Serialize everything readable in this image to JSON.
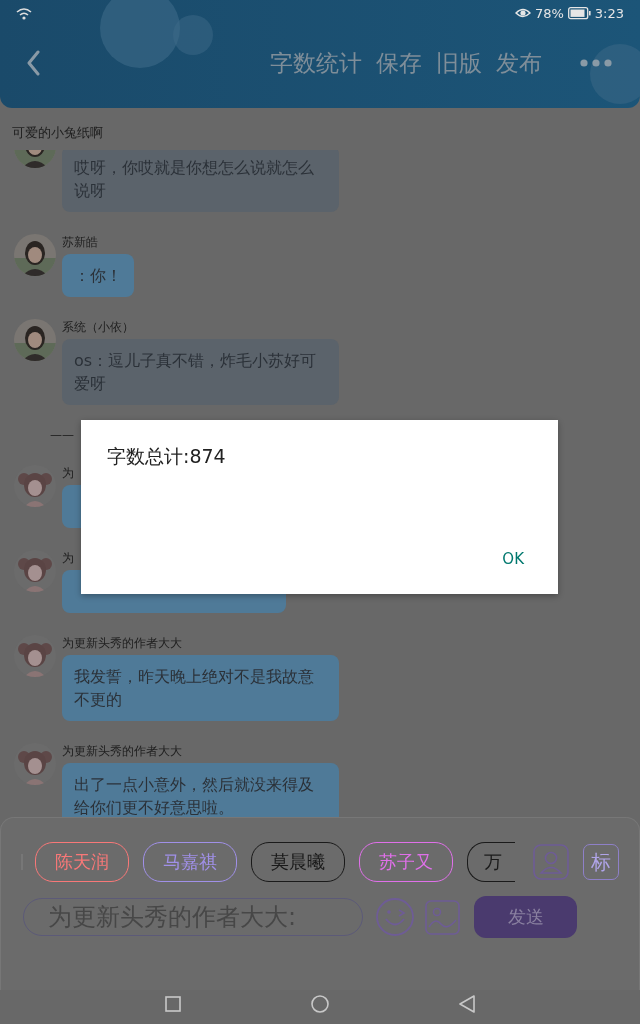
{
  "status_bar": {
    "battery": "78%",
    "time": "3:23"
  },
  "toolbar": {
    "actions": [
      "字数统计",
      "保存",
      "旧版",
      "发布"
    ]
  },
  "chat_title": "可爱的小兔纸啊",
  "messages": [
    {
      "kind": "message",
      "text": "哎呀，你哎就是你想怎么说就怎么说呀",
      "color": "#5b636b"
    },
    {
      "kind": "message",
      "sender": "苏新皓",
      "text": "：你！",
      "color": "#4f7a98"
    },
    {
      "kind": "message",
      "sender": "系统（小依）",
      "text": "os：逗儿子真不错，炸毛小苏好可爱呀",
      "color": "#5b636b"
    },
    {
      "kind": "separator",
      "text": "——"
    },
    {
      "kind": "message",
      "sender": "为",
      "color": "#4f7a98"
    },
    {
      "kind": "message",
      "sender": "为",
      "color": "#4f7a98"
    },
    {
      "kind": "message",
      "sender": "为更新头秀的作者大大",
      "text": "我发誓，昨天晚上绝对不是我故意不更的",
      "color": "#4f7a98"
    },
    {
      "kind": "message",
      "sender": "为更新头秀的作者大大",
      "text": "出了一点小意外，然后就没来得及给你们更不好意思啦。",
      "color": "#4f7a98"
    }
  ],
  "dialog": {
    "message": "字数总计:874",
    "button": "OK"
  },
  "composer": {
    "chips": [
      {
        "label": "陈天润",
        "color": "#f87878"
      },
      {
        "label": "马嘉祺",
        "color": "#a090e8"
      },
      {
        "label": "莫晨曦",
        "color": "#1a1a1a"
      },
      {
        "label": "苏子又",
        "color": "#e070ea"
      },
      {
        "label": "万",
        "color": "#1a1a1a"
      }
    ],
    "tag_button": "标",
    "input": "为更新头秀的作者大大:",
    "send": "发送"
  }
}
